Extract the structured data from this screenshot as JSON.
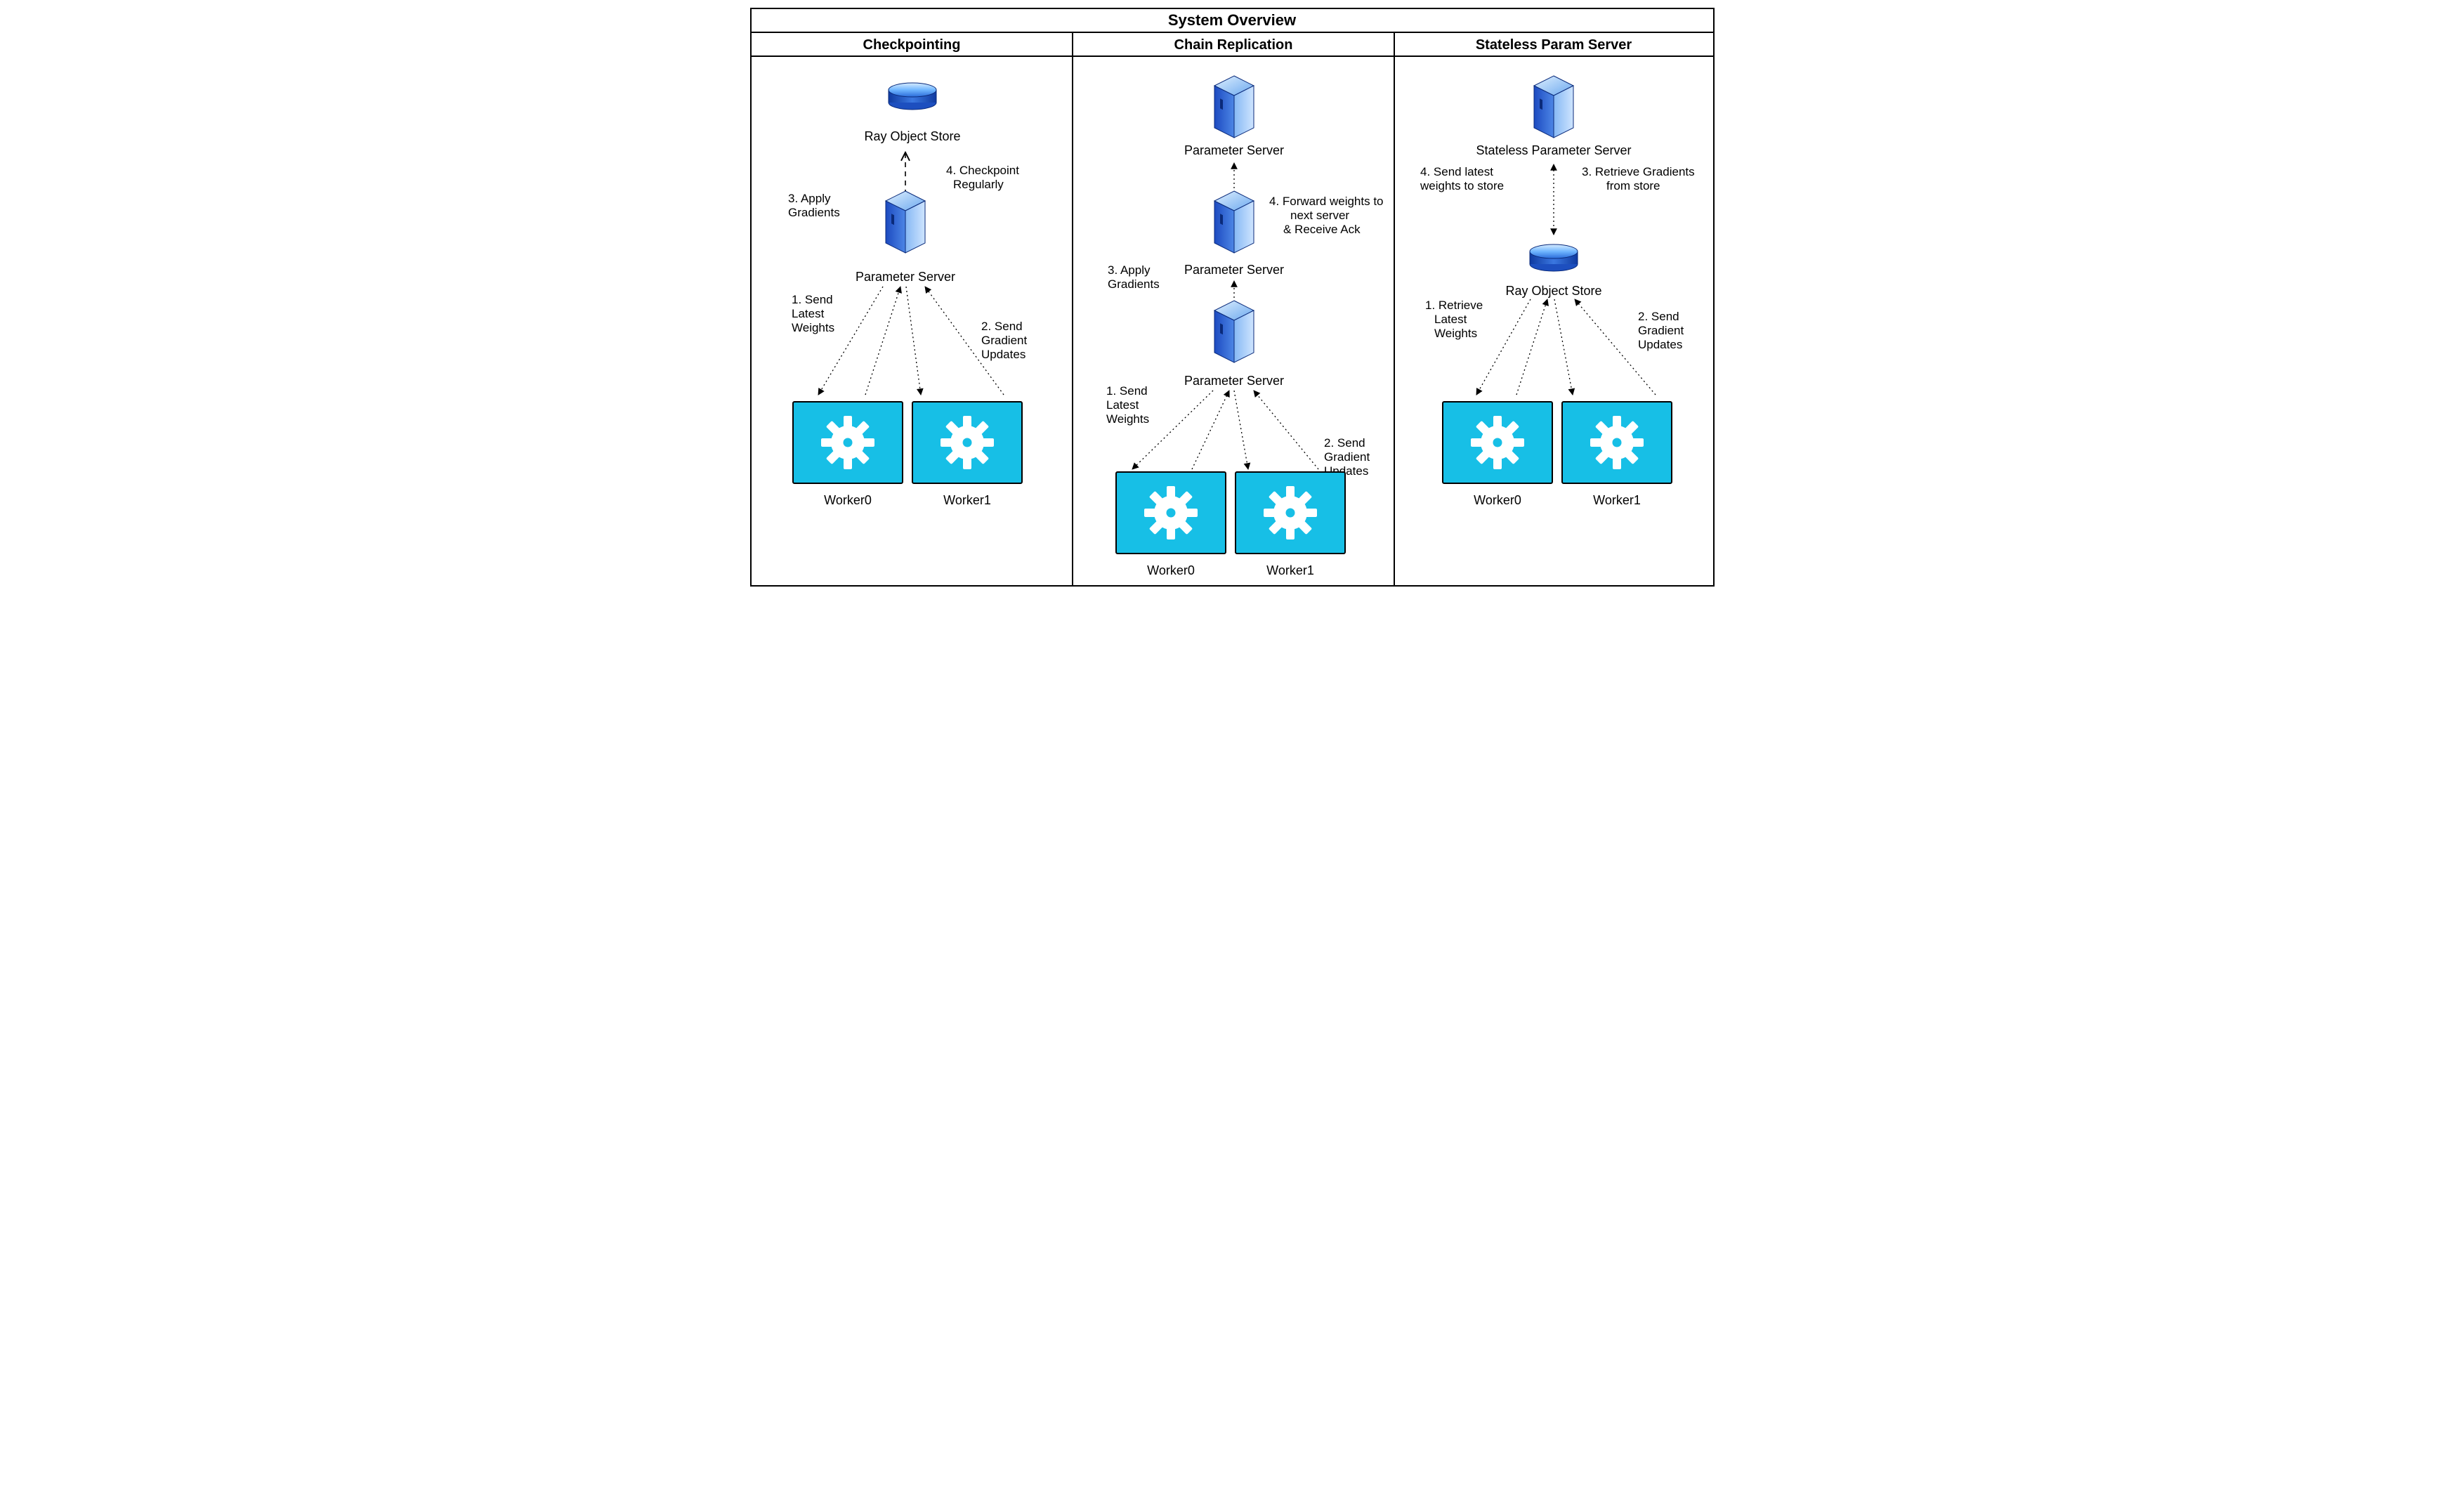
{
  "title": "System Overview",
  "columns": {
    "checkpointing": {
      "title": "Checkpointing"
    },
    "chain": {
      "title": "Chain Replication"
    },
    "stateless": {
      "title": "Stateless Param Server"
    }
  },
  "labels": {
    "rayStore": "Ray Object Store",
    "paramServer": "Parameter Server",
    "statelessParamServer": "Stateless Parameter Server",
    "worker0": "Worker0",
    "worker1": "Worker1"
  },
  "annotations": {
    "checkpointing": {
      "a1a": "1. Send",
      "a1b": "Latest",
      "a1c": "Weights",
      "a2a": "2. Send",
      "a2b": "Gradient",
      "a2c": "Updates",
      "a3a": "3. Apply",
      "a3b": "Gradients",
      "a4a": "4. Checkpoint",
      "a4b": "Regularly"
    },
    "chain": {
      "a1a": "1. Send",
      "a1b": "Latest",
      "a1c": "Weights",
      "a2a": "2. Send",
      "a2b": "Gradient",
      "a2c": "Updates",
      "a3a": "3. Apply",
      "a3b": "Gradients",
      "a4a": "4. Forward weights to",
      "a4b": "next server",
      "a4c": "& Receive Ack"
    },
    "stateless": {
      "a1a": "1. Retrieve",
      "a1b": "Latest",
      "a1c": "Weights",
      "a2a": "2. Send",
      "a2b": "Gradient",
      "a2c": "Updates",
      "a3a": "3. Retrieve Gradients",
      "a3b": "from store",
      "a4a": "4. Send latest",
      "a4b": "weights to store"
    }
  }
}
